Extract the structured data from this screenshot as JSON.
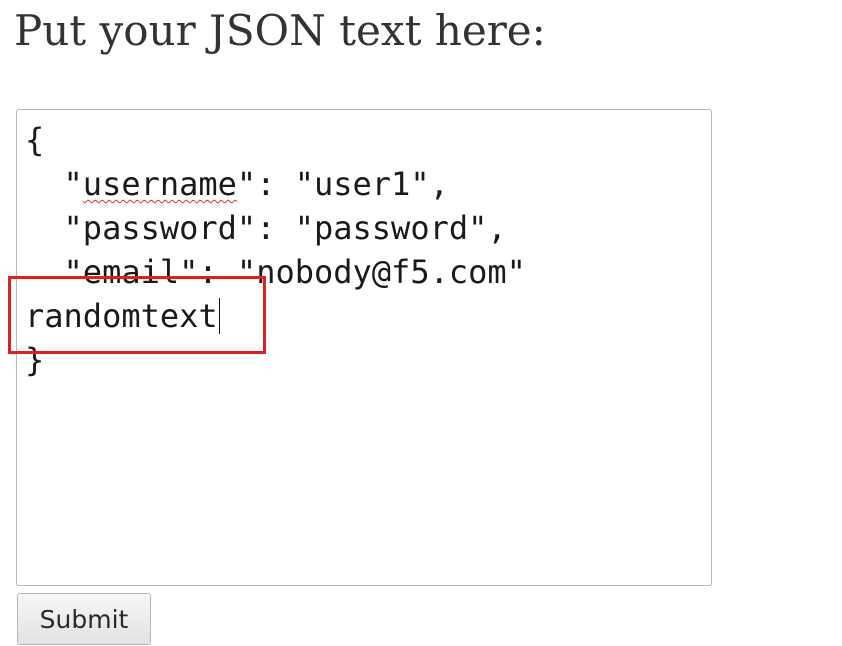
{
  "form": {
    "heading": "Put your JSON text here:",
    "json_textarea": {
      "lines": [
        "{",
        "  \"",
        "username",
        "\": \"user1\",",
        "  \"password\": \"password\",",
        "  \"email\": \"nobody@f5.com\"",
        "randomtext",
        "}"
      ]
    },
    "submit_label": "Submit"
  },
  "annotation": {
    "highlight_color": "#e02020",
    "spellcheck_color": "#e03030"
  }
}
